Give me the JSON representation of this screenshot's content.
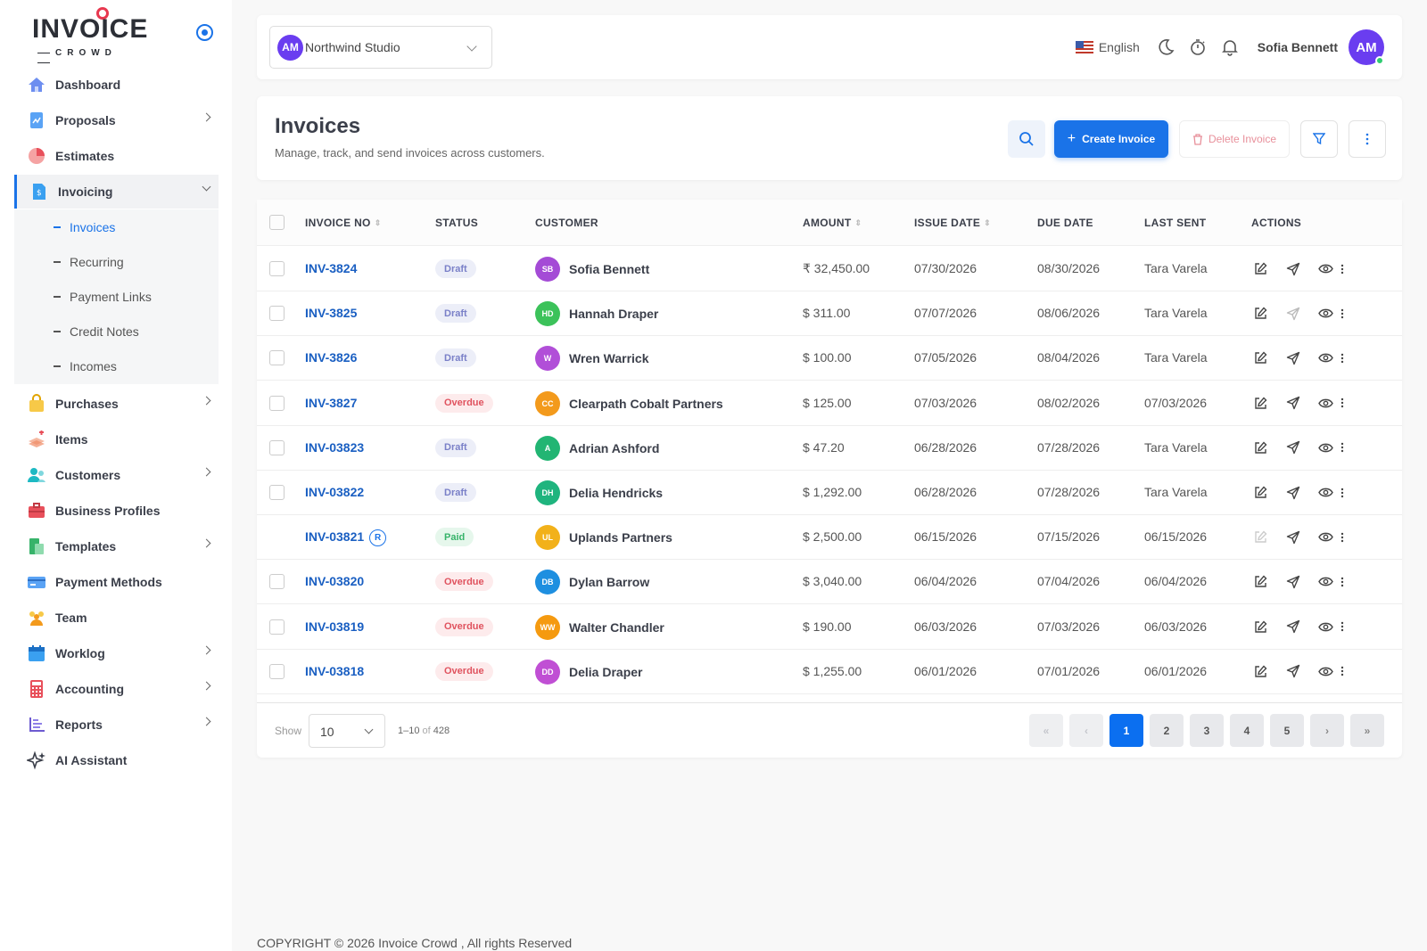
{
  "brand": {
    "logo_main": "INVOICE",
    "logo_sub": "CROWD"
  },
  "sidebar": {
    "items": [
      {
        "label": "Dashboard",
        "icon": "home-icon"
      },
      {
        "label": "Proposals",
        "icon": "proposal-icon"
      },
      {
        "label": "Estimates",
        "icon": "pie-chart-icon"
      },
      {
        "label": "Invoicing",
        "icon": "invoice-file-icon"
      },
      {
        "label": "Purchases",
        "icon": "shopping-bag-icon"
      },
      {
        "label": "Items",
        "icon": "layers-icon"
      },
      {
        "label": "Customers",
        "icon": "users-icon"
      },
      {
        "label": "Business Profiles",
        "icon": "briefcase-icon"
      },
      {
        "label": "Templates",
        "icon": "templates-icon"
      },
      {
        "label": "Payment Methods",
        "icon": "credit-card-icon"
      },
      {
        "label": "Team",
        "icon": "team-icon"
      },
      {
        "label": "Worklog",
        "icon": "calendar-icon"
      },
      {
        "label": "Accounting",
        "icon": "calculator-icon"
      },
      {
        "label": "Reports",
        "icon": "reports-icon"
      },
      {
        "label": "AI Assistant",
        "icon": "sparkle-icon"
      }
    ],
    "invoicing_sub": [
      "Invoices",
      "Recurring",
      "Payment Links",
      "Credit Notes",
      "Incomes"
    ]
  },
  "topbar": {
    "org_initials": "AM",
    "org_name": "Northwind Studio",
    "language": "English",
    "user_name": "Sofia Bennett",
    "user_initials": "AM"
  },
  "page": {
    "title": "Invoices",
    "subtitle": "Manage, track, and send invoices across customers.",
    "create_label": "Create Invoice",
    "delete_label": "Delete Invoice"
  },
  "table": {
    "headers": [
      "INVOICE NO",
      "STATUS",
      "CUSTOMER",
      "AMOUNT",
      "ISSUE DATE",
      "DUE DATE",
      "LAST SENT",
      "ACTIONS"
    ],
    "rows": [
      {
        "no": "INV-3824",
        "status": "Draft",
        "initials": "SB",
        "color": "#a44bd6",
        "customer": "Sofia Bennett",
        "amount": "₹ 32,450.00",
        "issue": "07/30/2026",
        "due": "08/30/2026",
        "sent": "Tara Varela"
      },
      {
        "no": "INV-3825",
        "status": "Draft",
        "initials": "HD",
        "color": "#3cc25a",
        "customer": "Hannah Draper",
        "amount": "$ 311.00",
        "issue": "07/07/2026",
        "due": "08/06/2026",
        "sent": "Tara Varela"
      },
      {
        "no": "INV-3826",
        "status": "Draft",
        "initials": "W",
        "color": "#b14fd8",
        "customer": "Wren Warrick",
        "amount": "$ 100.00",
        "issue": "07/05/2026",
        "due": "08/04/2026",
        "sent": "Tara Varela"
      },
      {
        "no": "INV-3827",
        "status": "Overdue",
        "initials": "CC",
        "color": "#f39a1c",
        "customer": "Clearpath Cobalt Partners",
        "amount": "$ 125.00",
        "issue": "07/03/2026",
        "due": "08/02/2026",
        "sent": "07/03/2026"
      },
      {
        "no": "INV-03823",
        "status": "Draft",
        "initials": "A",
        "color": "#22b573",
        "customer": "Adrian Ashford",
        "amount": "$ 47.20",
        "issue": "06/28/2026",
        "due": "07/28/2026",
        "sent": "Tara Varela"
      },
      {
        "no": "INV-03822",
        "status": "Draft",
        "initials": "DH",
        "color": "#1fb47e",
        "customer": "Delia Hendricks",
        "amount": "$ 1,292.00",
        "issue": "06/28/2026",
        "due": "07/28/2026",
        "sent": "Tara Varela"
      },
      {
        "no": "INV-03821",
        "status": "Paid",
        "initials": "UL",
        "color": "#f2b11a",
        "customer": "Uplands Partners",
        "amount": "$ 2,500.00",
        "issue": "06/15/2026",
        "due": "07/15/2026",
        "sent": "06/15/2026",
        "recurring": "R"
      },
      {
        "no": "INV-03820",
        "status": "Overdue",
        "initials": "DB",
        "color": "#1e8fe0",
        "customer": "Dylan Barrow",
        "amount": "$ 3,040.00",
        "issue": "06/04/2026",
        "due": "07/04/2026",
        "sent": "06/04/2026"
      },
      {
        "no": "INV-03819",
        "status": "Overdue",
        "initials": "WW",
        "color": "#f59a10",
        "customer": "Walter Chandler",
        "amount": "$ 190.00",
        "issue": "06/03/2026",
        "due": "07/03/2026",
        "sent": "06/03/2026"
      },
      {
        "no": "INV-03818",
        "status": "Overdue",
        "initials": "DD",
        "color": "#c04fd4",
        "customer": "Delia Draper",
        "amount": "$ 1,255.00",
        "issue": "06/01/2026",
        "due": "07/01/2026",
        "sent": "06/01/2026"
      }
    ]
  },
  "pagination": {
    "show_label": "Show",
    "page_size": "10",
    "range": "1–10",
    "of_label": "of",
    "total": "428",
    "pages": [
      "1",
      "2",
      "3",
      "4",
      "5"
    ],
    "current": "1"
  },
  "footer": {
    "copyright": "COPYRIGHT © 2026 Invoice Crowd , All rights Reserved"
  }
}
